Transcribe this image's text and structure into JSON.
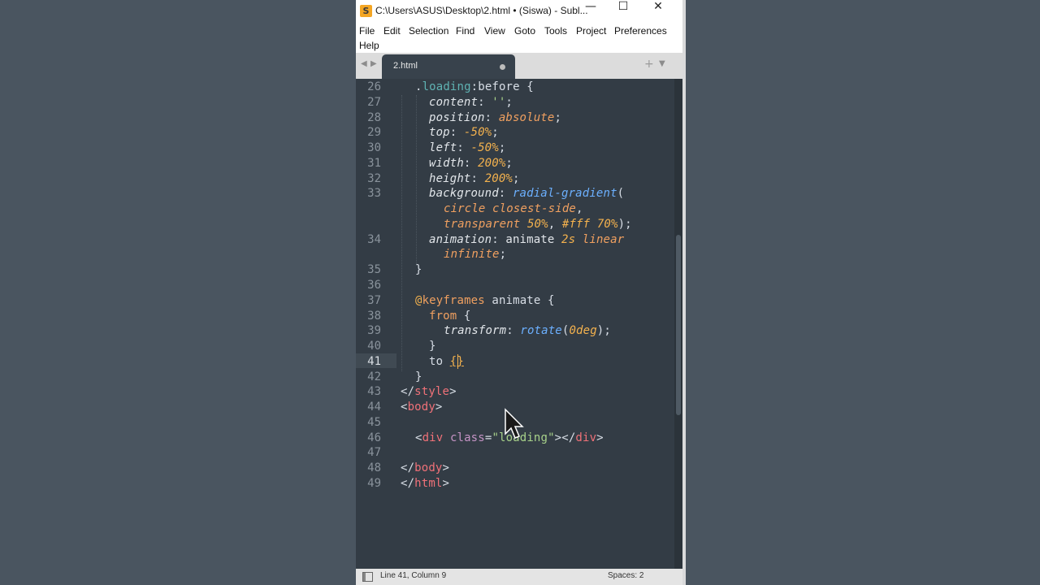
{
  "window": {
    "title": "C:\\Users\\ASUS\\Desktop\\2.html • (Siswa) - Subl...",
    "minimize": "—",
    "maximize": "☐",
    "close": "✕"
  },
  "menu": {
    "file": "File",
    "edit": "Edit",
    "selection": "Selection",
    "find": "Find",
    "view": "View",
    "goto": "Goto",
    "tools": "Tools",
    "project": "Project",
    "preferences": "Preferences",
    "help": "Help"
  },
  "tabs": {
    "back": "◀",
    "forward": "▶",
    "active_label": "2.html",
    "new_tab": "+",
    "menu": "▼"
  },
  "editor": {
    "lines": [
      "26",
      "27",
      "28",
      "29",
      "30",
      "31",
      "32",
      "33",
      "34",
      "35",
      "36",
      "37",
      "38",
      "39",
      "40",
      "41",
      "42",
      "43",
      "44",
      "45",
      "46",
      "47",
      "48",
      "49"
    ],
    "current_line": "41"
  },
  "status": {
    "position": "Line 41, Column 9",
    "spaces": "Spaces: 2"
  },
  "colors": {
    "editor_bg": "#333c45",
    "desktop_bg": "#4a5560",
    "app_icon": "#f4a624"
  },
  "icons": {
    "app": "sublime-text-icon",
    "mouse": "mouse-pointer-icon"
  }
}
